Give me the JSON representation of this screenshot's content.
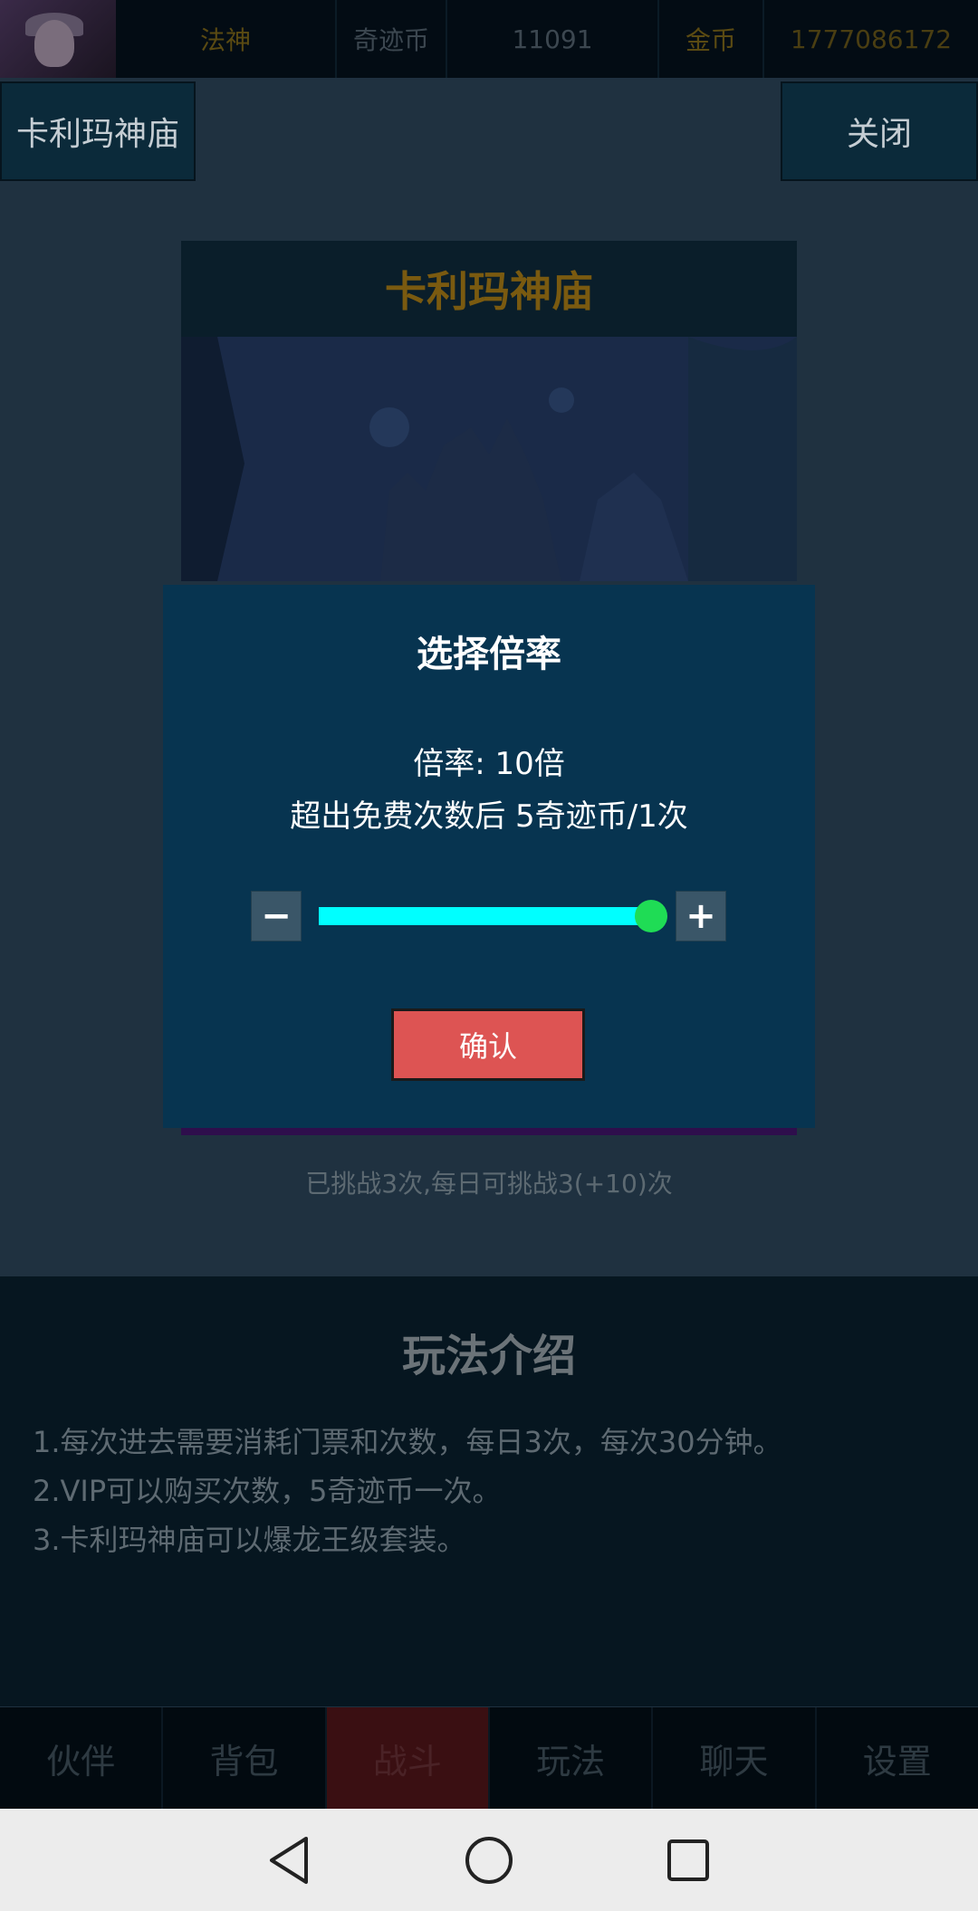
{
  "topbar": {
    "class_name": "法神",
    "miracle_coin_label": "奇迹币",
    "miracle_coin_value": "11091",
    "gold_label": "金币",
    "gold_value": "1777086172"
  },
  "header": {
    "location": "卡利玛神庙",
    "close_label": "关闭"
  },
  "card": {
    "title": "卡利玛神庙",
    "challenge_info": "已挑战3次,每日可挑战3(+10)次"
  },
  "intro": {
    "title": "玩法介绍",
    "lines": [
      "1.每次进去需要消耗门票和次数，每日3次，每次30分钟。",
      "2.VIP可以购买次数，5奇迹币一次。",
      "3.卡利玛神庙可以爆龙王级套装。"
    ]
  },
  "tabs": [
    "伙伴",
    "背包",
    "战斗",
    "玩法",
    "聊天",
    "设置"
  ],
  "active_tab": "战斗",
  "modal": {
    "title": "选择倍率",
    "rate_text": "倍率: 10倍",
    "cost_text": "超出免费次数后 5奇迹币/1次",
    "minus_label": "−",
    "plus_label": "+",
    "slider_level": 1.0,
    "confirm_label": "确认"
  },
  "colors": {
    "modal_bg": "#073450",
    "slider": "#00ffff",
    "thumb": "#1fdc55",
    "confirm": "#dd5453"
  }
}
